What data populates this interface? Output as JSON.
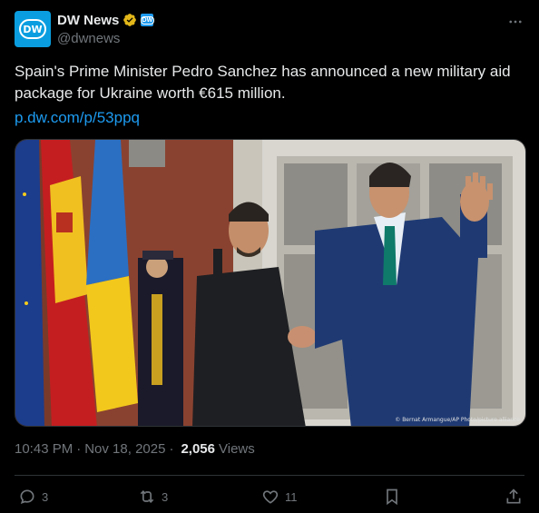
{
  "author": {
    "display_name": "DW News",
    "handle": "@dwnews",
    "avatar_text": "DW",
    "affiliate_badge": "DW"
  },
  "post": {
    "text": "Spain's Prime Minister Pedro Sanchez has announced a new military aid package for Ukraine worth €615 million.",
    "link": "p.dw.com/p/53ppq",
    "photo_credit": "© Bernat Armangue/AP Photo/picture alliance"
  },
  "meta": {
    "time": "10:43 PM",
    "separator": "·",
    "date": "Nov 18, 2025",
    "views_count": "2,056",
    "views_label": "Views"
  },
  "actions": {
    "replies": "3",
    "reposts": "3",
    "likes": "11"
  },
  "colors": {
    "background": "#000000",
    "text": "#e7e9ea",
    "muted": "#71767b",
    "link": "#1d9bf0",
    "verified_gold": "#e2b719",
    "brand": "#0a9ee0"
  }
}
